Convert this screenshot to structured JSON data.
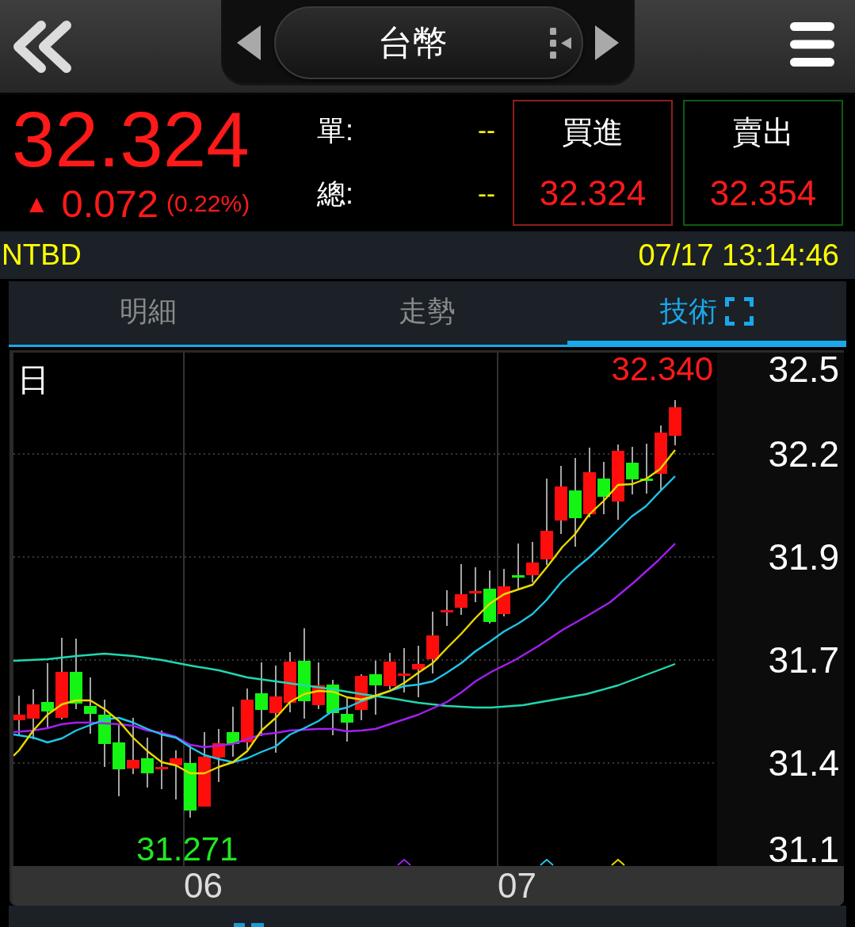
{
  "header": {
    "title": "台幣"
  },
  "quote": {
    "price": "32.324",
    "rising": true,
    "arrow": "▲",
    "change": "0.072",
    "change_percent": "(0.22%)"
  },
  "volumes": [
    {
      "label": "單:",
      "value": "--"
    },
    {
      "label": "總:",
      "value": "--"
    }
  ],
  "order_buttons": [
    {
      "kind": "buy",
      "label": "買進",
      "price": "32.324"
    },
    {
      "kind": "sell",
      "label": "賣出",
      "price": "32.354"
    }
  ],
  "status_bar": {
    "code": "NTBD",
    "timestamp": "07/17 13:14:46"
  },
  "tabs": [
    {
      "label": "明細",
      "selected": false
    },
    {
      "label": "走勢",
      "selected": false
    },
    {
      "label": "技術",
      "selected": true
    }
  ],
  "chart": {
    "period": "日",
    "high_label": "32.340",
    "low_label": "31.271",
    "y_axis_labels": [
      "32.5",
      "32.2",
      "31.9",
      "31.7",
      "31.4",
      "31.1"
    ],
    "x_axis_labels": [
      "06",
      "07"
    ]
  }
}
